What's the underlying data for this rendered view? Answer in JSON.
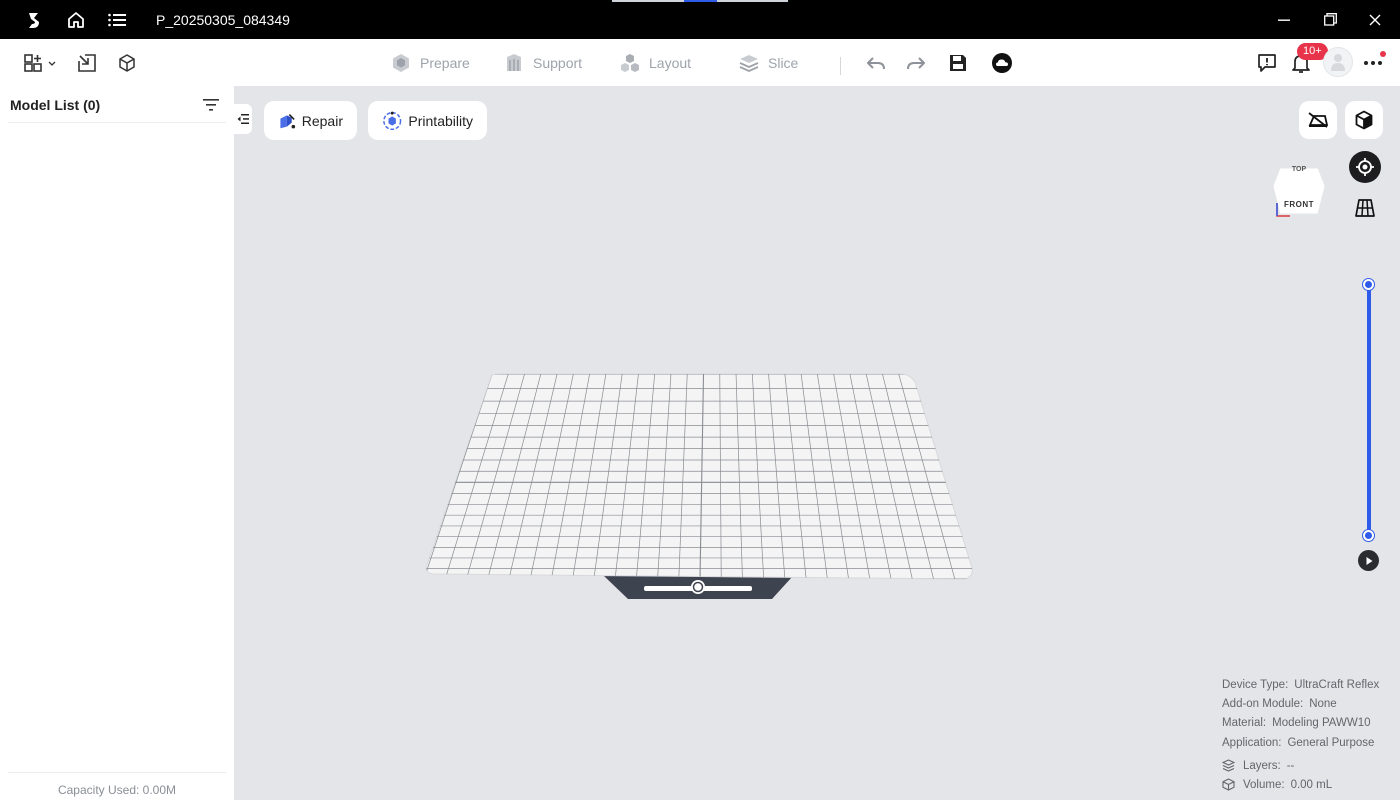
{
  "titlebar": {
    "title": "P_20250305_084349",
    "logo_icon": "app-logo-icon",
    "home_icon": "home-icon",
    "menu_icon": "menu-list-icon",
    "minimize_icon": "minimize-icon",
    "restore_icon": "restore-icon",
    "close_icon": "close-icon"
  },
  "toolbar": {
    "steps": [
      {
        "label": "Prepare",
        "icon": "prepare-icon"
      },
      {
        "label": "Support",
        "icon": "support-icon"
      },
      {
        "label": "Layout",
        "icon": "layout-icon"
      },
      {
        "label": "Slice",
        "icon": "slice-icon"
      }
    ],
    "notification_badge": "10+",
    "left_tools": [
      "add-model-icon",
      "import-icon",
      "model-cube-icon"
    ],
    "right_tools": [
      "undo-icon",
      "redo-icon",
      "save-icon",
      "cloud-icon",
      "feedback-icon",
      "bell-icon",
      "avatar",
      "more-icon"
    ]
  },
  "sidebar": {
    "title": "Model List (0)",
    "capacity": "Capacity Used: 0.00M"
  },
  "viewport": {
    "repair_label": "Repair",
    "printability_label": "Printability",
    "viewcube_top": "TOP",
    "viewcube_front": "FRONT",
    "info": {
      "device_type_label": "Device Type:",
      "device_type_value": "UltraCraft Reflex",
      "addon_label": "Add-on Module:",
      "addon_value": "None",
      "material_label": "Material:",
      "material_value": "Modeling PAWW10",
      "application_label": "Application:",
      "application_value": "General Purpose",
      "layers_label": "Layers:",
      "layers_value": "--",
      "volume_label": "Volume:",
      "volume_value": "0.00 mL"
    }
  },
  "colors": {
    "accent": "#2f5bea",
    "badge": "#e8344a",
    "viewport_bg": "#e4e5e8"
  }
}
